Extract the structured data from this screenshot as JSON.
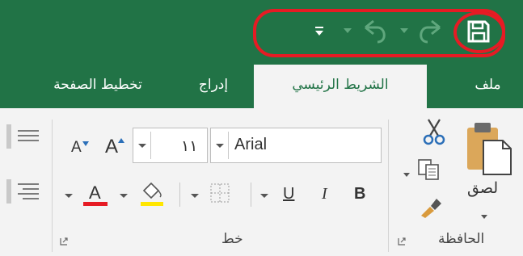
{
  "titlebar": {
    "qat_more_icon": "customize-toolbar-icon",
    "undo_icon": "undo-icon",
    "redo_icon": "redo-icon",
    "save_icon": "save-icon",
    "bg_color": "#217346",
    "highlight_color": "#e61b24"
  },
  "tabs": [
    {
      "label": "ملف"
    },
    {
      "label": "الشريط الرئيسي",
      "active": true
    },
    {
      "label": "إدراج"
    },
    {
      "label": "تخطيط الصفحة"
    }
  ],
  "clipboard": {
    "group_label": "الحافظة",
    "paste_label": "لصق"
  },
  "font": {
    "group_label": "خط",
    "font_name": "Arial",
    "font_size": "١١",
    "bold": "B",
    "italic": "I",
    "underline": "U",
    "font_color": "#e61b24",
    "highlight_color": "#ffe600",
    "grow_label": "A",
    "shrink_label": "A",
    "color_label": "A"
  }
}
